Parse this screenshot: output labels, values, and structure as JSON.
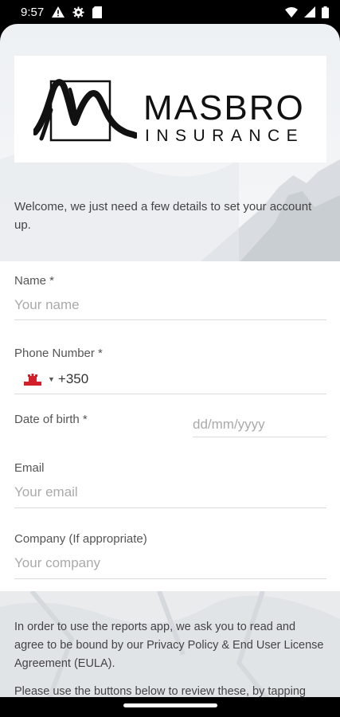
{
  "status_bar": {
    "time": "9:57",
    "left_icons": [
      "warning-icon",
      "gear-icon",
      "sim-card-icon"
    ],
    "right_icons": [
      "wifi-icon",
      "signal-icon",
      "battery-icon"
    ]
  },
  "logo": {
    "brand_name": "MASBRO",
    "brand_subtitle": "INSURANCE"
  },
  "welcome_text": "Welcome, we just need a few details to set your account up.",
  "form": {
    "name": {
      "label": "Name *",
      "placeholder": "Your name"
    },
    "phone": {
      "label": "Phone Number *",
      "flag": "gibraltar-flag-icon",
      "dial_code": "+350"
    },
    "dob": {
      "label": "Date of birth *",
      "placeholder": "dd/mm/yyyy"
    },
    "email": {
      "label": "Email",
      "placeholder": "Your email"
    },
    "company": {
      "label": "Company (If appropriate)",
      "placeholder": "Your company"
    }
  },
  "terms": {
    "paragraph1": "In order to use the reports app, we ask you to read and agree to be bound by our Privacy Policy & End User License Agreement (EULA).",
    "paragraph2": "Please use the buttons below to review these, by tapping"
  },
  "colors": {
    "form_bg": "#ffffff",
    "divider": "#dcdcdc",
    "placeholder": "#aaaaaa",
    "label": "#555555"
  }
}
